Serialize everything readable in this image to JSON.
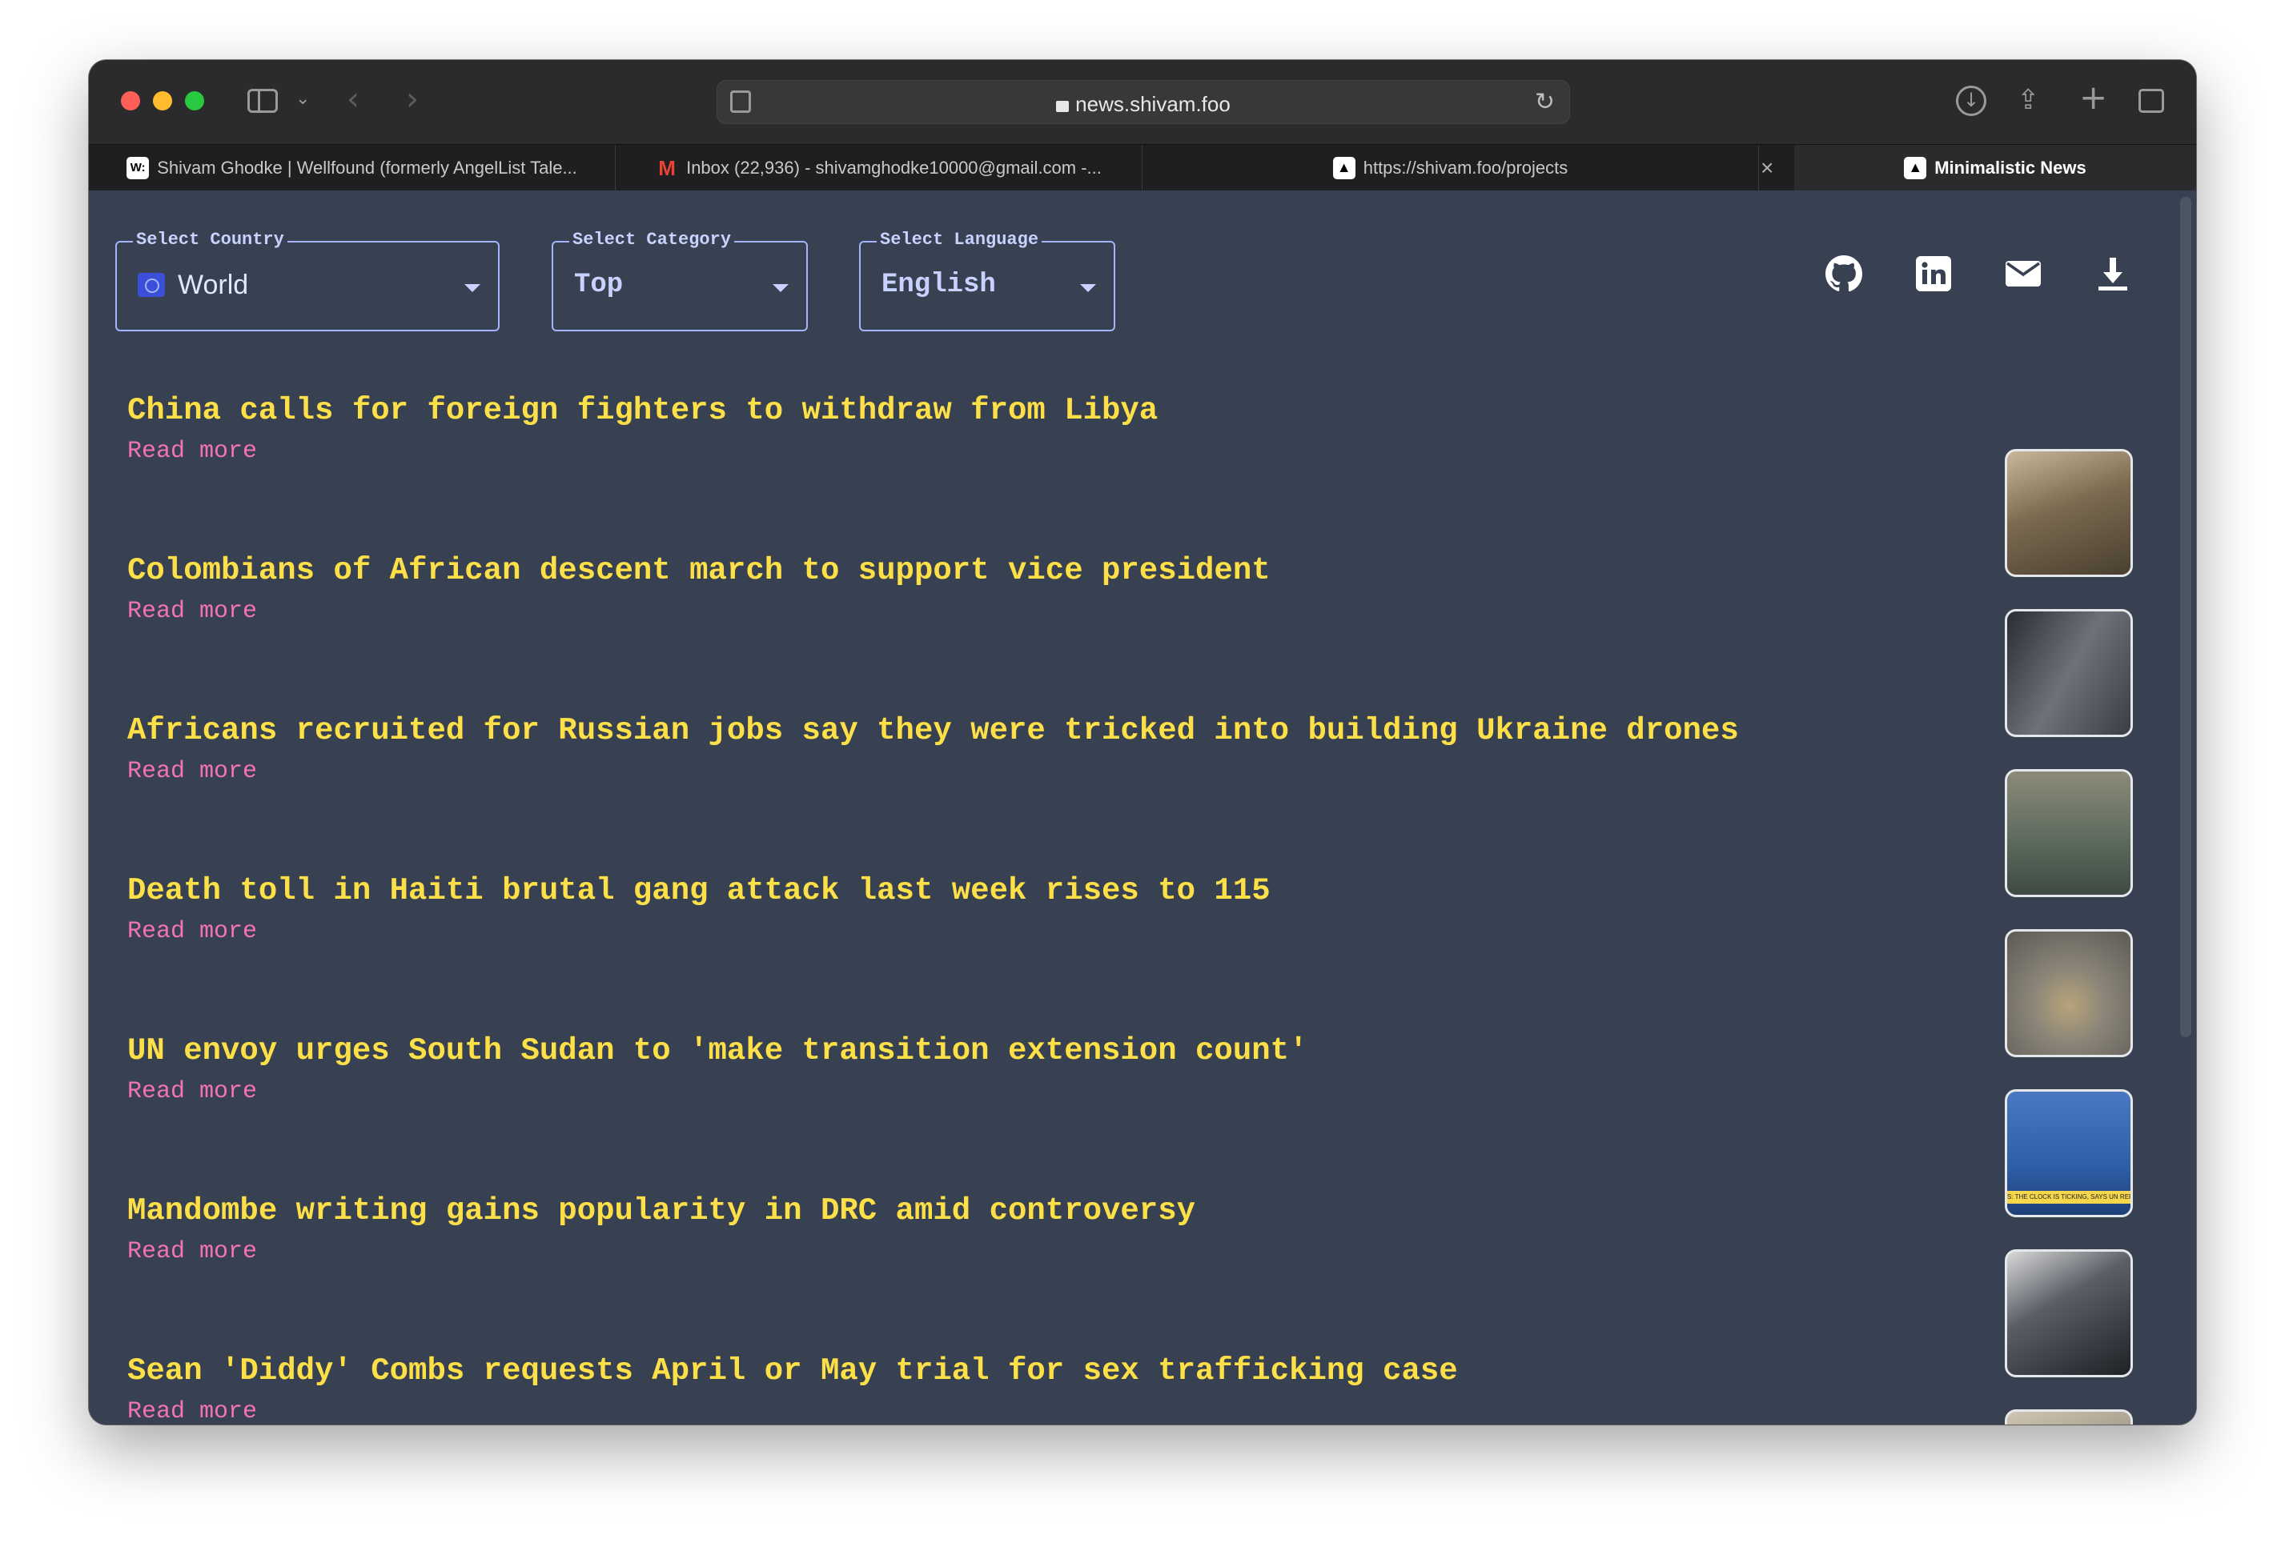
{
  "browser": {
    "url": "news.shivam.foo",
    "tabs": [
      {
        "label": "Shivam Ghodke | Wellfound (formerly AngelList Tale...",
        "favicon": "W:"
      },
      {
        "label": "Inbox (22,936) - shivamghodke10000@gmail.com -...",
        "favicon": "M"
      },
      {
        "label": "https://shivam.foo/projects",
        "favicon": "triangle-logo"
      },
      {
        "label": "Minimalistic News",
        "favicon": "triangle-logo"
      }
    ]
  },
  "filters": {
    "country": {
      "legend": "Select Country",
      "value": "World"
    },
    "category": {
      "legend": "Select Category",
      "value": "Top"
    },
    "language": {
      "legend": "Select Language",
      "value": "English"
    }
  },
  "social_icons": [
    "github-icon",
    "linkedin-icon",
    "mail-icon",
    "download-icon"
  ],
  "news": [
    {
      "title": "China calls for foreign fighters to withdraw from Libya",
      "link": "Read more",
      "thumb_color": "#7a6a50"
    },
    {
      "title": "Colombians of African descent march to support vice president",
      "link": "Read more",
      "thumb_color": "#4b4f55"
    },
    {
      "title": "Africans recruited for Russian jobs say they were tricked into building Ukraine drones",
      "link": "Read more",
      "thumb_color": "#6b6a55"
    },
    {
      "title": "Death toll in Haiti brutal gang attack last week rises to 115",
      "link": "Read more",
      "thumb_color": "#8a8478"
    },
    {
      "title": "UN envoy urges South Sudan to 'make transition extension count'",
      "link": "Read more",
      "thumb_color": "#2f5fa8",
      "thumb_caption": "S: THE CLOCK IS TICKING, SAYS UN REPRES"
    },
    {
      "title": "Mandombe writing gains popularity in DRC amid controversy",
      "link": "Read more",
      "thumb_color": "#5a5e66"
    },
    {
      "title": "Sean 'Diddy' Combs requests April or May trial for sex trafficking case",
      "link": "Read more",
      "thumb_color": "#9a9080"
    }
  ],
  "colors": {
    "background": "#374151",
    "headline": "#fde047",
    "link": "#f472b6",
    "field_border": "#a5b4fc"
  }
}
